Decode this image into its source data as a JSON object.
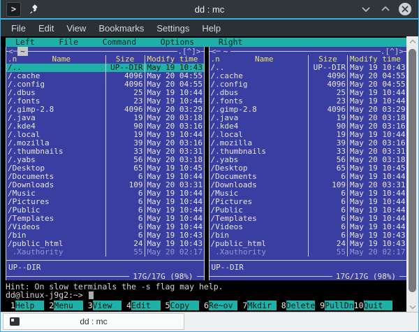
{
  "window": {
    "title": "dd : mc",
    "app_icon_glyph": ">"
  },
  "menubar": {
    "items": [
      "File",
      "Edit",
      "View",
      "Bookmarks",
      "Settings",
      "Help"
    ]
  },
  "mc": {
    "menu_items": [
      "Left",
      "File",
      "Command",
      "Options",
      "Right"
    ],
    "dir": "~",
    "panel_top_left": "<─",
    "panel_top_right": ".[^]>",
    "columns": {
      "sort": ".n",
      "name": "Name",
      "size": "Size",
      "mtime": "Modify time"
    },
    "rows": [
      {
        "name": "/..",
        "size": "UP--DIR",
        "time": "May 19 10:43"
      },
      {
        "name": "/.cache",
        "size": "4096",
        "time": "May 20 04:55"
      },
      {
        "name": "/.config",
        "size": "4096",
        "time": "May 20 04:55"
      },
      {
        "name": "/.dbus",
        "size": "25",
        "time": "May 19 10:44"
      },
      {
        "name": "/.fonts",
        "size": "23",
        "time": "May 19 10:44"
      },
      {
        "name": "/.gimp-2.8",
        "size": "4096",
        "time": "May 20 03:29"
      },
      {
        "name": "/.java",
        "size": "19",
        "time": "May 20 03:18"
      },
      {
        "name": "/.kde4",
        "size": "90",
        "time": "May 20 03:16"
      },
      {
        "name": "/.local",
        "size": "19",
        "time": "May 19 10:44"
      },
      {
        "name": "/.mozilla",
        "size": "39",
        "time": "May 20 03:16"
      },
      {
        "name": "/.thumbnails",
        "size": "33",
        "time": "May 20 03:31"
      },
      {
        "name": "/.yabs",
        "size": "56",
        "time": "May 20 03:18"
      },
      {
        "name": "/Desktop",
        "size": "65",
        "time": "May 19 10:45"
      },
      {
        "name": "/Documents",
        "size": "6",
        "time": "May 19 10:44"
      },
      {
        "name": "/Downloads",
        "size": "109",
        "time": "May 20 03:31"
      },
      {
        "name": "/Music",
        "size": "6",
        "time": "May 19 10:44"
      },
      {
        "name": "/Pictures",
        "size": "6",
        "time": "May 19 10:44"
      },
      {
        "name": "/Public",
        "size": "6",
        "time": "May 19 10:44"
      },
      {
        "name": "/Templates",
        "size": "6",
        "time": "May 19 10:44"
      },
      {
        "name": "/Videos",
        "size": "6",
        "time": "May 19 10:44"
      },
      {
        "name": "/bin",
        "size": "6",
        "time": "May 19 10:43"
      },
      {
        "name": "/public_html",
        "size": "24",
        "time": "May 19 10:43"
      },
      {
        "name": ".Xauthority",
        "size": "55",
        "time": "May 20 02:17",
        "dim": true
      }
    ],
    "panels": [
      {
        "side": "left",
        "active": true,
        "selected_index": 0
      },
      {
        "side": "right",
        "active": false,
        "selected_index": null
      }
    ],
    "mini_status": "UP--DIR",
    "disk_usage": "17G/17G (98%)",
    "hint": "Hint: On slow terminals the -s flag may help.",
    "prompt": "dd@linux-j9g2:~>",
    "fkeys": [
      {
        "num": "1",
        "label": "Help"
      },
      {
        "num": "2",
        "label": "Menu"
      },
      {
        "num": "3",
        "label": "View"
      },
      {
        "num": "4",
        "label": "Edit"
      },
      {
        "num": "5",
        "label": "Copy"
      },
      {
        "num": "6",
        "label": "Re~ov"
      },
      {
        "num": "7",
        "label": "Mkdir"
      },
      {
        "num": "8",
        "label": "Delete"
      },
      {
        "num": "9",
        "label": "PullDn"
      },
      {
        "num": "10",
        "label": "Quit"
      }
    ]
  },
  "tabbar": {
    "tab_label": "dd : mc"
  },
  "colors": {
    "panel_bg": "#3b3ea1",
    "cyan": "#1fb1a7",
    "yellow": "#e3e374",
    "text": "#e6e6e6",
    "frame": "#c9cde0",
    "dim_text": "#9298cc",
    "accent": "#3daee9",
    "titlebar": "#31363b",
    "terminal_bg": "#000000"
  }
}
